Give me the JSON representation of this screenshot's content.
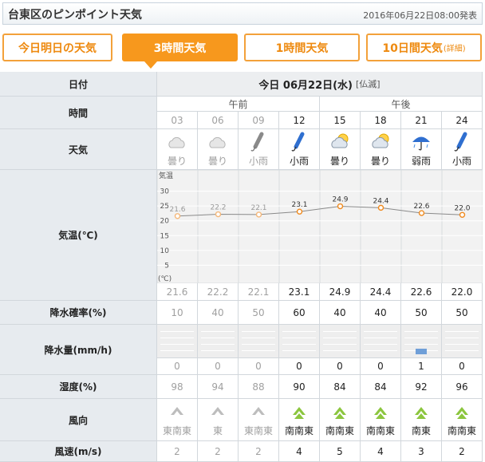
{
  "title": "台東区のピンポイント天気",
  "published": "2016年06月22日08:00発表",
  "tabs": [
    {
      "label": "今日明日の天気",
      "small": ""
    },
    {
      "label": "3時間天気",
      "small": ""
    },
    {
      "label": "1時間天気",
      "small": ""
    },
    {
      "label": "10日間天気",
      "small": "(詳細)"
    }
  ],
  "active_tab": 1,
  "table": {
    "labels": {
      "date": "日付",
      "time": "時間",
      "weather": "天気",
      "temp": "気温(℃)",
      "precip_prob": "降水確率(%)",
      "precip_amt": "降水量(mm/h)",
      "humidity": "湿度(%)",
      "wind_dir": "風向",
      "wind_speed": "風速(m/s)"
    },
    "date_heading": "今日 06月22日(水)",
    "rokuyo": "[仏滅]",
    "am": "午前",
    "pm": "午後",
    "hours": [
      "03",
      "06",
      "09",
      "12",
      "15",
      "18",
      "21",
      "24"
    ],
    "past_count": 3,
    "weather_text": [
      "曇り",
      "曇り",
      "小雨",
      "小雨",
      "曇り",
      "曇り",
      "弱雨",
      "小雨"
    ],
    "weather_icons": [
      "cloud-icon",
      "cloud-icon",
      "closed-umbrella-icon",
      "closed-umbrella-icon",
      "cloud-sun-icon",
      "cloud-sun-icon",
      "umbrella-rain-icon",
      "closed-umbrella-icon"
    ],
    "temps": [
      "21.6",
      "22.2",
      "22.1",
      "23.1",
      "24.9",
      "24.4",
      "22.6",
      "22.0"
    ],
    "precip_prob": [
      "10",
      "40",
      "50",
      "60",
      "40",
      "40",
      "50",
      "50"
    ],
    "precip_amt": [
      "0",
      "0",
      "0",
      "0",
      "0",
      "0",
      "1",
      "0"
    ],
    "humidity": [
      "98",
      "94",
      "88",
      "90",
      "84",
      "84",
      "92",
      "96"
    ],
    "wind_dir": [
      "東南東",
      "東",
      "東南東",
      "南南東",
      "南南東",
      "南南東",
      "南東",
      "南南東"
    ],
    "wind_icons": [
      "wind-arrow-icon",
      "wind-arrow-icon",
      "wind-arrow-icon",
      "wind-arrow-icon",
      "wind-arrow-icon",
      "wind-arrow-icon",
      "wind-arrow-icon",
      "wind-arrow-icon"
    ],
    "wind_speed": [
      "2",
      "2",
      "2",
      "4",
      "5",
      "4",
      "3",
      "2"
    ]
  },
  "chart_data": {
    "type": "line",
    "x": [
      "03",
      "06",
      "09",
      "12",
      "15",
      "18",
      "21",
      "24"
    ],
    "series": [
      {
        "values": [
          21.6,
          22.2,
          22.1,
          23.1,
          24.9,
          24.4,
          22.6,
          22.0
        ]
      }
    ],
    "ylabel": "気温",
    "yunit": "(℃)",
    "yticks": [
      30,
      25,
      20,
      15,
      10,
      5
    ],
    "ylim": [
      0,
      35
    ],
    "grid": true,
    "line_color": "#8a8a8a",
    "marker_color": "#f08a1e"
  },
  "colors": {
    "accent": "#f7981d",
    "rain_bar": "#6f9fd8",
    "wind_icon": "#8cc63f"
  }
}
